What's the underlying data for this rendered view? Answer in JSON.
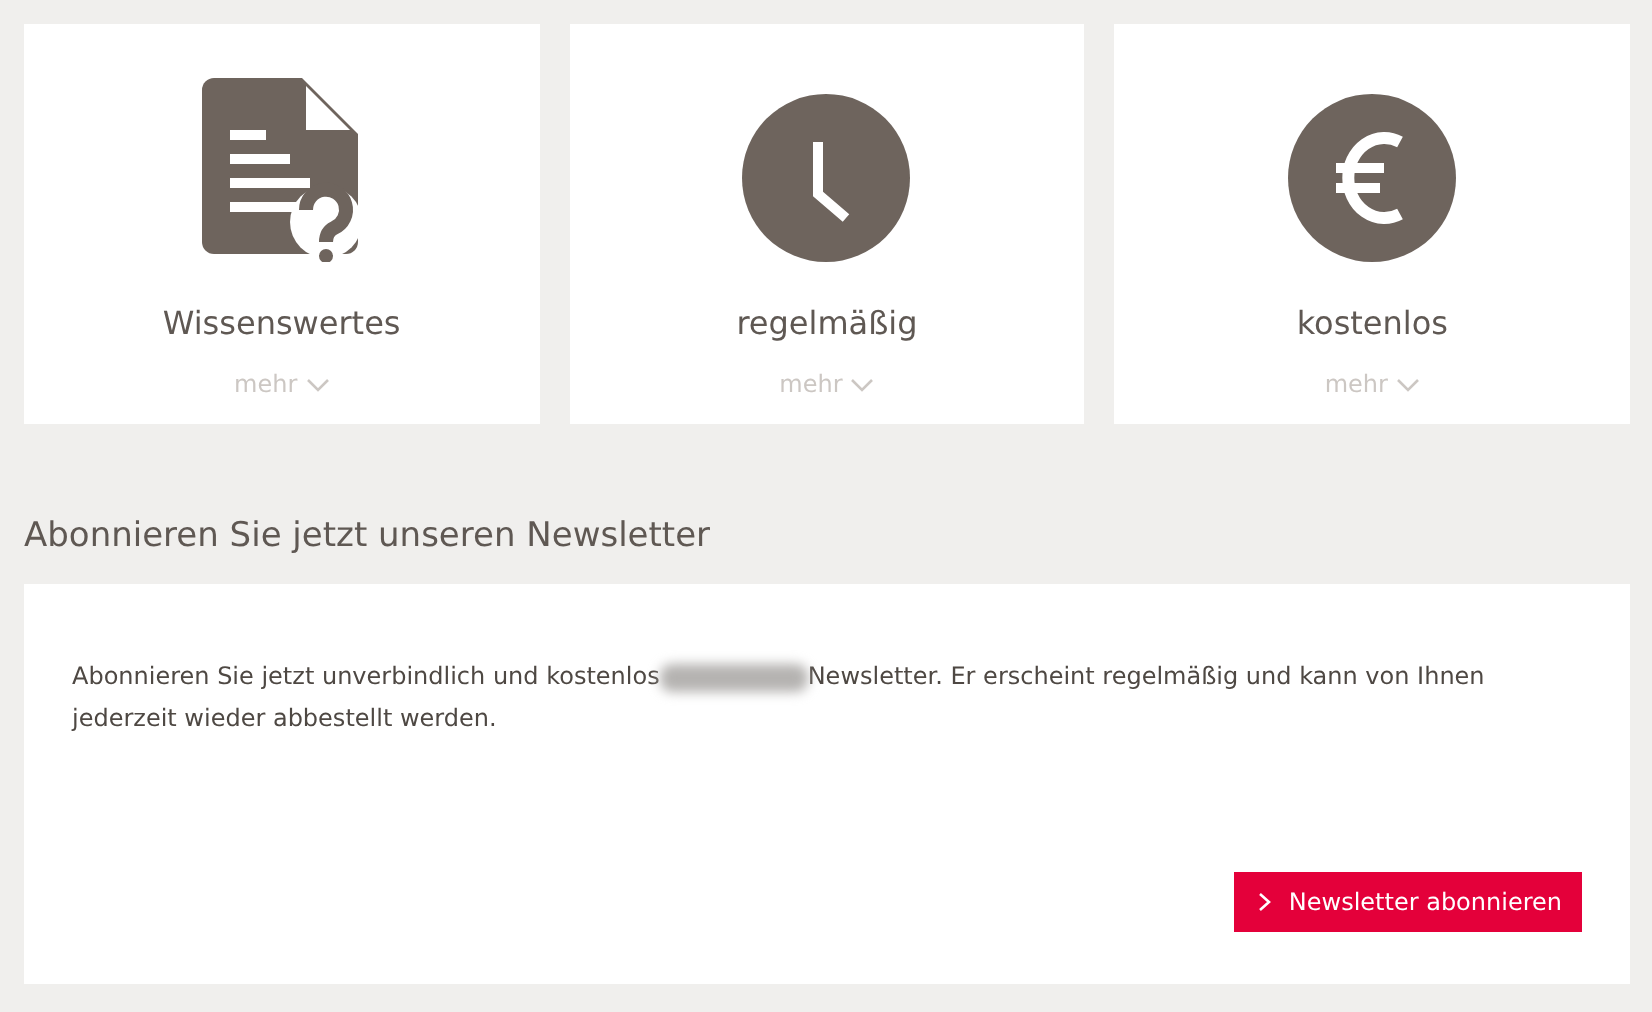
{
  "features": [
    {
      "kind": "document",
      "title": "Wissenswertes",
      "more": "mehr"
    },
    {
      "kind": "clock",
      "title": "regelmäßig",
      "more": "mehr"
    },
    {
      "kind": "euro",
      "title": "kostenlos",
      "more": "mehr"
    }
  ],
  "newsletter": {
    "heading": "Abonnieren Sie jetzt unseren Newsletter",
    "text_before": "Abonnieren Sie jetzt unverbindlich und kostenlos",
    "text_after": "Newsletter. Er erscheint regelmäßig und kann von Ihnen jederzeit wieder abbestellt werden.",
    "button": "Newsletter abonnieren"
  }
}
